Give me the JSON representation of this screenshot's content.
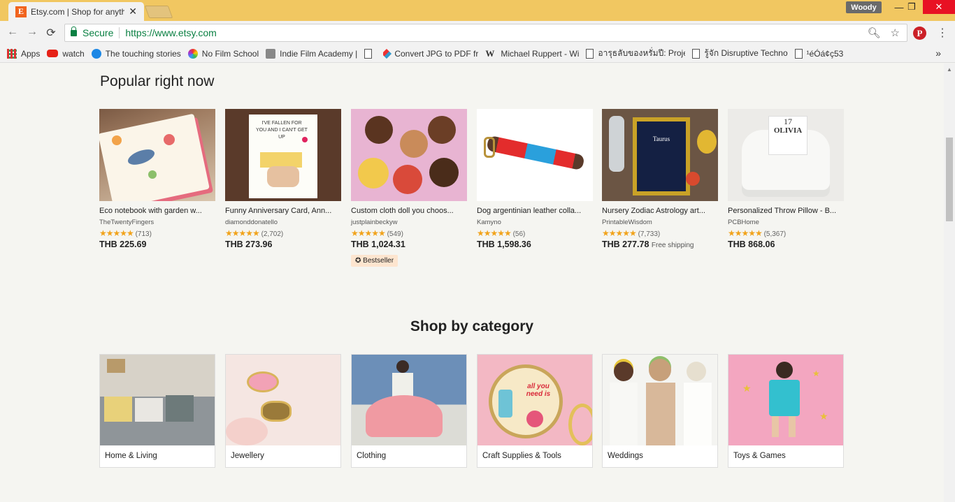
{
  "browser": {
    "tab_title": "Etsy.com | Shop for anyth",
    "tab_favicon": "E",
    "user": "Woody",
    "secure_label": "Secure",
    "url": "https://www.etsy.com",
    "pinterest_letter": "P"
  },
  "bookmarks": [
    {
      "label": "Apps",
      "icon": "apps-grid-icon"
    },
    {
      "label": "watch",
      "icon": "youtube-icon"
    },
    {
      "label": "The touching stories",
      "icon": "blue-circle-icon"
    },
    {
      "label": "No Film School",
      "icon": "color-wheel-icon"
    },
    {
      "label": "Indie Film Academy |",
      "icon": "app-icon"
    },
    {
      "label": "",
      "icon": "page-icon"
    },
    {
      "label": "Convert JPG to PDF fr",
      "icon": "diamond-icon"
    },
    {
      "label": "Michael Ruppert - Wi",
      "icon": "wikipedia-icon"
    },
    {
      "label": "อารุธลับของหรั่มปี: Proje",
      "icon": "page-icon"
    },
    {
      "label": "รู้จัก Disruptive Techno",
      "icon": "page-icon"
    },
    {
      "label": "¹éÓá¢ç53",
      "icon": "page-icon"
    }
  ],
  "popular": {
    "heading": "Popular right now",
    "items": [
      {
        "title": "Eco notebook with garden w...",
        "shop": "TheTwentyFingers",
        "stars": "★★★★★",
        "reviews": "(713)",
        "price": "THB 225.69",
        "extra": "",
        "badge": ""
      },
      {
        "title": "Funny Anniversary Card, Ann...",
        "shop": "diamonddonatello",
        "stars": "★★★★★",
        "reviews": "(2,702)",
        "price": "THB 273.96",
        "extra": "",
        "badge": ""
      },
      {
        "title": "Custom cloth doll you choos...",
        "shop": "justplainbeckyw",
        "stars": "★★★★★",
        "reviews": "(549)",
        "price": "THB 1,024.31",
        "extra": "",
        "badge": "Bestseller"
      },
      {
        "title": "Dog argentinian leather colla...",
        "shop": "Kamyno",
        "stars": "★★★★★",
        "reviews": "(56)",
        "price": "THB 1,598.36",
        "extra": "",
        "badge": ""
      },
      {
        "title": "Nursery Zodiac Astrology art...",
        "shop": "PrintableWisdom",
        "stars": "★★★★★",
        "reviews": "(7,733)",
        "price": "THB 277.78",
        "extra": "Free shipping",
        "badge": ""
      },
      {
        "title": "Personalized Throw Pillow - B...",
        "shop": "PCBHome",
        "stars": "★★★★★",
        "reviews": "(5,367)",
        "price": "THB 868.06",
        "extra": "",
        "badge": ""
      }
    ]
  },
  "image_text": {
    "card": "I'VE FALLEN FOR YOU AND I CAN'T GET UP",
    "zodiac": "Taurus",
    "pillow_number": "17",
    "pillow_name": "OLIVIA",
    "craft": "all you need is"
  },
  "categories": {
    "heading": "Shop by category",
    "items": [
      {
        "label": "Home & Living"
      },
      {
        "label": "Jewellery"
      },
      {
        "label": "Clothing"
      },
      {
        "label": "Craft Supplies & Tools"
      },
      {
        "label": "Weddings"
      },
      {
        "label": "Toys & Games"
      }
    ]
  },
  "colors": {
    "etsy_orange": "#f1641e",
    "chrome_frame": "#f1c761",
    "star": "#f1a31b",
    "secure_green": "#0b8043"
  }
}
